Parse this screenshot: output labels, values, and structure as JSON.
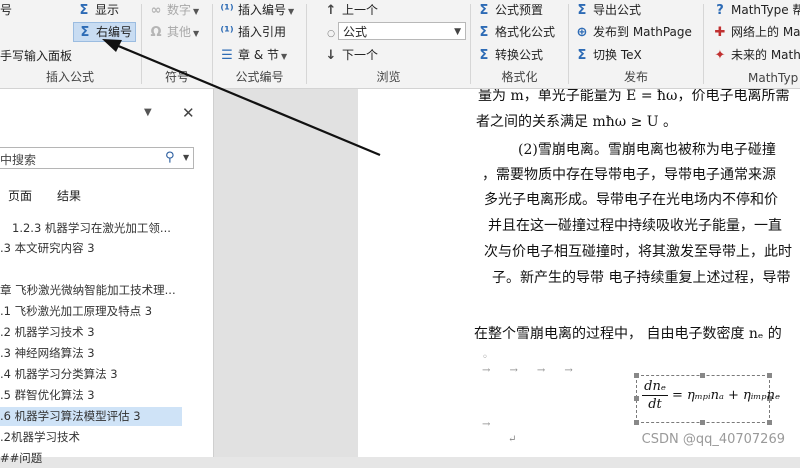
{
  "ribbon": {
    "groups": {
      "insert_formula": {
        "label": "插入公式",
        "btn_show": "显示",
        "btn_right_number": "右编号",
        "btn_handwrite": "手写输入面板",
        "btn_left_fragment": "号"
      },
      "symbols": {
        "label": "符号",
        "btn_digits": "数字",
        "btn_other": "其他"
      },
      "formula_number": {
        "label": "公式编号",
        "btn_insert_number": "插入编号",
        "btn_insert_ref": "插入引用",
        "btn_chapter": "章 & 节"
      },
      "browse": {
        "label": "浏览",
        "btn_prev": "上一个",
        "combo_value": "公式",
        "btn_next": "下一个"
      },
      "format": {
        "label": "格式化",
        "btn_preset": "公式预置",
        "btn_format": "格式化公式",
        "btn_convert": "转换公式"
      },
      "publish": {
        "label": "发布",
        "btn_export": "导出公式",
        "btn_publish_mathpage": "发布到 MathPage",
        "btn_toggle_tex": "切换 TeX"
      },
      "mathtype": {
        "label": "MathTyp",
        "btn_help": "MathType 帮",
        "btn_online": "网络上的 Ma",
        "btn_future": "未来的 Math"
      }
    }
  },
  "nav": {
    "search_placeholder": "中搜索",
    "tabs": [
      "页面",
      "结果"
    ],
    "items": [
      "1.2.3  机器学习在激光加工领...",
      ".3  本文研究内容 3",
      "章  飞秒激光微纳智能加工技术理...",
      ".1  飞秒激光加工原理及特点 3",
      ".2   机器学习技术 3",
      ".3   神经网络算法 3",
      ".4   机器学习分类算法 3",
      ".5   群智优化算法 3",
      ".6   机器学习算法模型评估 3",
      ".2机器学习技术",
      "##问题"
    ]
  },
  "doc": {
    "lines": [
      "量为 m，单光子能量为 E = ħω，价电子电离所需",
      "者之间的关系满足 mħω ≥ U 。",
      "(2)雪崩电离。雪崩电离也被称为电子碰撞",
      "，需要物质中存在导带电子，导带电子通常来源",
      "多光子电离形成。导带电子在光电场内不停和价",
      "并且在这一碰撞过程中持续吸收光子能量，一直",
      "次与价电子相互碰撞时，将其激发至导带上，此时",
      "子。新产生的导带  电子持续重复上述过程，导带",
      "在整个雪崩电离的过程中，  自由电子数密度 nₑ 的"
    ],
    "equation": {
      "numerator": "dnₑ",
      "denominator": "dt",
      "rhs": "= ηₘₚᵢnₐ + ηᵢₘₚnₑ"
    },
    "watermark": "CSDN @qq_40707269"
  }
}
